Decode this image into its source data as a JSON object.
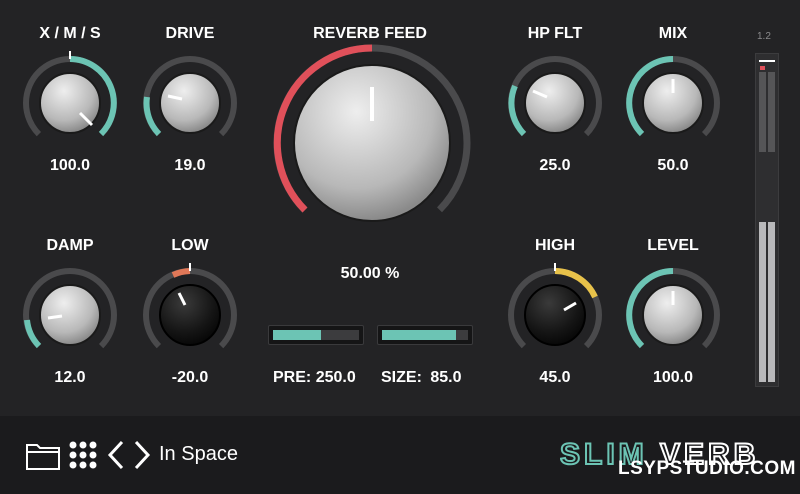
{
  "knobs": {
    "xms": {
      "label": "X / M / S",
      "value": "100.0"
    },
    "drive": {
      "label": "DRIVE",
      "value": "19.0"
    },
    "reverb_feed": {
      "label": "REVERB FEED",
      "value": "50.00 %"
    },
    "hp_flt": {
      "label": "HP FLT",
      "value": "25.0"
    },
    "mix": {
      "label": "MIX",
      "value": "50.0"
    },
    "damp": {
      "label": "DAMP",
      "value": "12.0"
    },
    "low": {
      "label": "LOW",
      "value": "-20.0"
    },
    "high": {
      "label": "HIGH",
      "value": "45.0"
    },
    "level": {
      "label": "LEVEL",
      "value": "100.0"
    }
  },
  "sliders": {
    "pre": {
      "label": "PRE:",
      "value": "250.0",
      "fill_fraction": 0.56
    },
    "size": {
      "label": "SIZE:",
      "value": "85.0",
      "fill_fraction": 0.86
    }
  },
  "meter": {
    "scale_label": "1.2",
    "level_fraction": 0.72
  },
  "footer": {
    "preset_name": "In Space",
    "brand_logo": "SLIMVERB",
    "brand_site": "LSYPSTUDIO.COM"
  },
  "colors": {
    "teal": "#6cc4b4",
    "red": "#e0505a",
    "orange": "#e07858",
    "yellow": "#e8c24a",
    "knob_silver": "#c8c8c8",
    "knob_black": "#141414",
    "ring": "#4a4a4c"
  }
}
